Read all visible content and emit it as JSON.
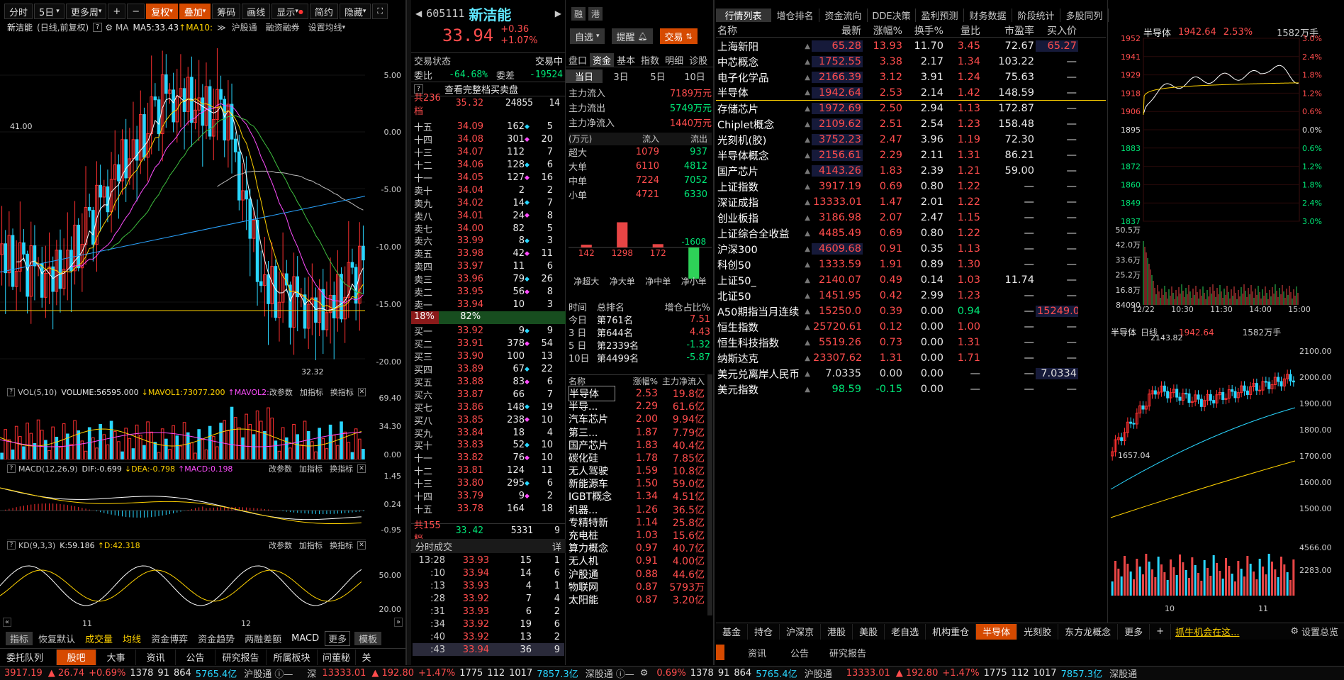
{
  "toolbar": {
    "buttons": [
      "分时",
      "5日",
      "更多周",
      "+",
      "−",
      "复权",
      "叠加",
      "筹码",
      "画线",
      "显示",
      "简约",
      "隐藏"
    ]
  },
  "chart_header": {
    "name": "新洁能",
    "mode": "(日线,前复权)",
    "ma_label": "MA",
    "ma5": "MA5:33.43",
    "ma10": "MA10:",
    "links": [
      "沪股通",
      "融资融券",
      "设置均线"
    ]
  },
  "price_axis": [
    "5.00",
    "0.00",
    "-5.00",
    "-10.00",
    "-15.00",
    "-20.00"
  ],
  "kline_marks": {
    "high": "41.00",
    "low": "32.32"
  },
  "vol": {
    "label": "VOL(5,10)",
    "volume": "VOLUME:56595.000",
    "mavol1": "MAVOL1:73077.200",
    "mavol2": "MAVOL2:",
    "tools": [
      "改参数",
      "加指标",
      "换指标"
    ],
    "axis": [
      "69.40",
      "34.30",
      "0.00"
    ]
  },
  "macd": {
    "label": "MACD(12,26,9)",
    "dif": "DIF:-0.699",
    "dea": "DEA:-0.798",
    "macd": "MACD:0.198",
    "tools": [
      "改参数",
      "加指标",
      "换指标"
    ],
    "axis": [
      "1.45",
      "0.24",
      "-0.95"
    ]
  },
  "kd": {
    "label": "KD(9,3,3)",
    "k": "K:59.186",
    "d": "D:42.318",
    "tools": [
      "改参数",
      "加指标",
      "换指标"
    ],
    "axis": [
      "50.00",
      "20.00"
    ]
  },
  "x_axis": [
    "11",
    "12"
  ],
  "bottom_left_tabs": [
    "指标",
    "恢复默认",
    "成交量",
    "均线",
    "资金博弈",
    "资金趋势",
    "两融差额",
    "MACD",
    "更多",
    "模板"
  ],
  "bottom_left_tabs2": [
    "委托队列",
    "股吧",
    "大事",
    "资讯",
    "公告",
    "研究报告",
    "所属板块",
    "问董秘",
    "关"
  ],
  "stock": {
    "code": "605111",
    "name": "新洁能",
    "tag1": "融",
    "tag2": "港",
    "price": "33.94",
    "chg": "+0.36",
    "pct": "+1.07%",
    "zixuan": "自选",
    "tixing": "提醒",
    "jiaoyi": "交易"
  },
  "orderbook": {
    "status_label": "交易状态",
    "status": "交易中",
    "wb_label": "委比",
    "wb": "-64.68%",
    "wc_label": "委差",
    "wc": "-19524",
    "full_link": "查看完整档买卖盘",
    "sell_total": {
      "label": "共236档",
      "price": "35.32",
      "vol": "24855",
      "cnt": "14"
    },
    "sell": [
      [
        "十五",
        "34.09",
        "162",
        "5"
      ],
      [
        "十四",
        "34.08",
        "301",
        "20"
      ],
      [
        "十三",
        "34.07",
        "112",
        "7"
      ],
      [
        "十二",
        "34.06",
        "128",
        "6"
      ],
      [
        "十一",
        "34.05",
        "127",
        "16"
      ],
      [
        "卖十",
        "34.04",
        "2",
        "2"
      ],
      [
        "卖九",
        "34.02",
        "14",
        "7"
      ],
      [
        "卖八",
        "34.01",
        "24",
        "8"
      ],
      [
        "卖七",
        "34.00",
        "82",
        "5"
      ],
      [
        "卖六",
        "33.99",
        "8",
        "3"
      ],
      [
        "卖五",
        "33.98",
        "42",
        "11"
      ],
      [
        "卖四",
        "33.97",
        "11",
        "6"
      ],
      [
        "卖三",
        "33.96",
        "79",
        "26"
      ],
      [
        "卖二",
        "33.95",
        "56",
        "8"
      ],
      [
        "卖一",
        "33.94",
        "10",
        "3"
      ]
    ],
    "ratio_left": "18%",
    "ratio_right": "82%",
    "buy": [
      [
        "买一",
        "33.92",
        "9",
        "9"
      ],
      [
        "买二",
        "33.91",
        "378",
        "54"
      ],
      [
        "买三",
        "33.90",
        "100",
        "13"
      ],
      [
        "买四",
        "33.89",
        "67",
        "22"
      ],
      [
        "买五",
        "33.88",
        "83",
        "6"
      ],
      [
        "买六",
        "33.87",
        "66",
        "7"
      ],
      [
        "买七",
        "33.86",
        "148",
        "19"
      ],
      [
        "买八",
        "33.85",
        "238",
        "10"
      ],
      [
        "买九",
        "33.84",
        "18",
        "4"
      ],
      [
        "买十",
        "33.83",
        "52",
        "10"
      ],
      [
        "十一",
        "33.82",
        "76",
        "10"
      ],
      [
        "十二",
        "33.81",
        "124",
        "11"
      ],
      [
        "十三",
        "33.80",
        "295",
        "6"
      ],
      [
        "十四",
        "33.79",
        "9",
        "2"
      ],
      [
        "十五",
        "33.78",
        "164",
        "18"
      ]
    ],
    "buy_total": {
      "label": "共155档",
      "price": "33.42",
      "vol": "5331",
      "cnt": "9"
    }
  },
  "ticks": {
    "title": "分时成交",
    "detail": "详",
    "rows": [
      [
        "13:28",
        "33.93",
        "15",
        "1"
      ],
      [
        ":10",
        "33.94",
        "14",
        "6"
      ],
      [
        ":13",
        "33.93",
        "4",
        "1"
      ],
      [
        ":28",
        "33.92",
        "7",
        "4"
      ],
      [
        ":31",
        "33.93",
        "6",
        "2"
      ],
      [
        ":34",
        "33.92",
        "19",
        "6"
      ],
      [
        ":40",
        "33.92",
        "13",
        "2"
      ],
      [
        ":43",
        "33.94",
        "36",
        "9"
      ]
    ]
  },
  "fund": {
    "tabs": [
      "盘口",
      "资金",
      "基本",
      "指数",
      "明细",
      "诊股"
    ],
    "periods": [
      "当日",
      "3日",
      "5日",
      "10日"
    ],
    "flows": [
      [
        "主力流入",
        "7189万元"
      ],
      [
        "主力流出",
        "5749万元"
      ],
      [
        "主力净流入",
        "1440万元"
      ]
    ],
    "head": [
      "(万元)",
      "流入",
      "流出"
    ],
    "rows": [
      [
        "超大",
        "1079",
        "937"
      ],
      [
        "大单",
        "6110",
        "4812"
      ],
      [
        "中单",
        "7224",
        "7052"
      ],
      [
        "小单",
        "4721",
        "6330"
      ]
    ],
    "bars": [
      {
        "label": "净超大",
        "value": "142"
      },
      {
        "label": "净大单",
        "value": "1298"
      },
      {
        "label": "净中单",
        "value": "172"
      },
      {
        "label": "净小单",
        "value": "-1608"
      }
    ],
    "rank_head": [
      "时间",
      "总排名",
      "增仓占比%"
    ],
    "rank": [
      [
        "今日",
        "第761名",
        "7.51"
      ],
      [
        "3 日",
        "第644名",
        "4.43"
      ],
      [
        "5 日",
        "第2339名",
        "-1.32"
      ],
      [
        "10日",
        "第4499名",
        "-5.87"
      ]
    ]
  },
  "sectors": {
    "head": [
      "名称",
      "涨幅%",
      "主力净流入"
    ],
    "rows": [
      [
        "半导体",
        "2.53",
        "19.8亿"
      ],
      [
        "半导...",
        "2.29",
        "61.6亿"
      ],
      [
        "汽车芯片",
        "2.00",
        "9.94亿"
      ],
      [
        "第三...",
        "1.87",
        "7.79亿"
      ],
      [
        "国产芯片",
        "1.83",
        "40.4亿"
      ],
      [
        "碳化硅",
        "1.78",
        "7.85亿"
      ],
      [
        "无人驾驶",
        "1.59",
        "10.8亿"
      ],
      [
        "新能源车",
        "1.50",
        "59.0亿"
      ],
      [
        "IGBT概念",
        "1.34",
        "4.51亿"
      ],
      [
        "机器...",
        "1.26",
        "36.5亿"
      ],
      [
        "专精特新",
        "1.14",
        "25.8亿"
      ],
      [
        "充电桩",
        "1.03",
        "15.6亿"
      ],
      [
        "算力概念",
        "0.97",
        "40.7亿"
      ],
      [
        "无人机",
        "0.91",
        "4.00亿"
      ],
      [
        "沪股通",
        "0.88",
        "44.6亿"
      ],
      [
        "物联网",
        "0.87",
        "5793万"
      ],
      [
        "太阳能",
        "0.87",
        "3.20亿"
      ]
    ]
  },
  "market_tabs": [
    "行情列表",
    "增仓排名",
    "资金流向",
    "DDE决策",
    "盈利预测",
    "财务数据",
    "阶段统计",
    "多股同列"
  ],
  "market_head": [
    "名称",
    "最新",
    "涨幅%",
    "换手%",
    "量比",
    "市盈率",
    "买入价"
  ],
  "market": [
    [
      "上海新阳",
      "65.28",
      "13.93",
      "11.70",
      "3.45",
      "72.67",
      "65.27"
    ],
    [
      "中芯概念",
      "1752.55",
      "3.38",
      "2.17",
      "1.34",
      "103.22",
      "—"
    ],
    [
      "电子化学品",
      "2166.39",
      "3.12",
      "3.91",
      "1.24",
      "75.63",
      "—"
    ],
    [
      "半导体",
      "1942.64",
      "2.53",
      "2.14",
      "1.42",
      "148.59",
      "—"
    ],
    [
      "存储芯片",
      "1972.69",
      "2.50",
      "2.94",
      "1.13",
      "172.87",
      "—"
    ],
    [
      "Chiplet概念",
      "2109.62",
      "2.51",
      "2.54",
      "1.23",
      "158.48",
      "—"
    ],
    [
      "光刻机(胶)",
      "3752.23",
      "2.47",
      "3.96",
      "1.19",
      "72.30",
      "—"
    ],
    [
      "半导体概念",
      "2156.61",
      "2.29",
      "2.11",
      "1.31",
      "86.21",
      "—"
    ],
    [
      "国产芯片",
      "4143.26",
      "1.83",
      "2.39",
      "1.21",
      "59.00",
      "—"
    ],
    [
      "上证指数",
      "3917.19",
      "0.69",
      "0.80",
      "1.22",
      "—",
      "—"
    ],
    [
      "深证成指",
      "13333.01",
      "1.47",
      "2.01",
      "1.22",
      "—",
      "—"
    ],
    [
      "创业板指",
      "3186.98",
      "2.07",
      "2.47",
      "1.15",
      "—",
      "—"
    ],
    [
      "上证综合全收益",
      "4485.49",
      "0.69",
      "0.80",
      "1.22",
      "—",
      "—"
    ],
    [
      "沪深300",
      "4609.68",
      "0.91",
      "0.35",
      "1.13",
      "—",
      "—"
    ],
    [
      "科创50",
      "1333.59",
      "1.91",
      "0.89",
      "1.30",
      "—",
      "—"
    ],
    [
      "上证50_",
      "2140.07",
      "0.49",
      "0.14",
      "1.03",
      "11.74",
      "—"
    ],
    [
      "北证50",
      "1451.95",
      "0.42",
      "2.99",
      "1.23",
      "—",
      "—"
    ],
    [
      "A50期指当月连续",
      "15250.0",
      "0.39",
      "0.00",
      "0.94",
      "—",
      "15249.0"
    ],
    [
      "恒生指数",
      "25720.61",
      "0.12",
      "0.00",
      "1.00",
      "—",
      "—"
    ],
    [
      "恒生科技指数",
      "5519.26",
      "0.73",
      "0.00",
      "1.31",
      "—",
      "—"
    ],
    [
      "纳斯达克",
      "23307.62",
      "1.31",
      "0.00",
      "1.71",
      "—",
      "—"
    ],
    [
      "美元兑离岸人民币",
      "7.0335",
      "0.00",
      "0.00",
      "—",
      "—",
      "7.0334"
    ],
    [
      "美元指数",
      "98.59",
      "-0.15",
      "0.00",
      "—",
      "—",
      "—"
    ]
  ],
  "mini": {
    "name": "半导体",
    "price": "1942.64",
    "pct": "2.53%",
    "amount": "1582万手",
    "left_axis": [
      "1952",
      "1941",
      "1929",
      "1918",
      "1906",
      "1895",
      "1883",
      "1872",
      "1860",
      "1849",
      "1837"
    ],
    "right_axis": [
      "3.0%",
      "2.4%",
      "1.8%",
      "1.2%",
      "0.6%",
      "0.0%",
      "0.6%",
      "1.2%",
      "1.8%",
      "2.4%",
      "3.0%"
    ],
    "vol_axis": [
      "50.5万",
      "42.0万",
      "33.6万",
      "25.2万",
      "16.8万",
      "84090"
    ],
    "times": [
      "12/22",
      "10:30",
      "11:30",
      "14:00",
      "15:00"
    ],
    "daily_name": "半导体",
    "daily_mode": "日线",
    "daily_price": "1942.64",
    "daily_amount": "1582万手",
    "daily_high": "2143.82",
    "daily_low": "1657.04",
    "daily_axis": [
      "2100.00",
      "2000.00",
      "1900.00",
      "1800.00",
      "1700.00",
      "1600.00",
      "1500.00"
    ],
    "daily_vol_axis": [
      "4566.00",
      "2283.00"
    ],
    "daily_x": [
      "10",
      "11",
      "12"
    ]
  },
  "bottom_tabs": [
    "基金",
    "持仓",
    "沪深京",
    "港股",
    "美股",
    "老自选",
    "机构重仓",
    "半导体",
    "光刻胶",
    "东方龙概念",
    "更多",
    "+"
  ],
  "promo": "抓牛机会在这...",
  "settings": "设置总览",
  "right_bottom_tabs": [
    "资讯",
    "公告",
    "研究报告"
  ],
  "status_bar": {
    "sh": "3917.19",
    "sh_chg": "▲ 26.74",
    "sh_pct": "+0.69%",
    "sh_vol": "1378",
    "n1": "91",
    "n2": "864",
    "sh_amt": "5765.4亿",
    "hgt": "沪股通",
    "shen": "深",
    "sz": "13333.01",
    "sz_chg": "▲ 192.80",
    "sz_pct": "+1.47%",
    "sz_vol": "1775",
    "n3": "112",
    "n4": "1017",
    "sz_amt": "7857.3亿",
    "sgt": "深股通",
    "r_pct": "0.69%",
    "r_vol": "1378",
    "r_n1": "91",
    "r_n2": "864",
    "r_amt": "5765.4亿",
    "r_hgt": "沪股通",
    "r_sz": "13333.01",
    "r_chg": "▲ 192.80",
    "r_spct": "+1.47%",
    "r_svol": "1775",
    "r_n3": "112",
    "r_n4": "1017",
    "r_samt": "7857.3亿",
    "r_sgt": "深股通"
  }
}
